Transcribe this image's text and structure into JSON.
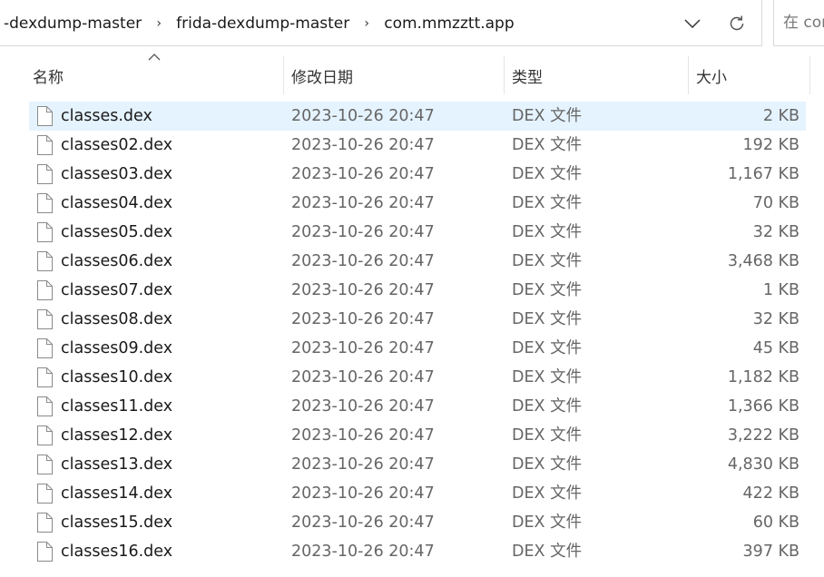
{
  "breadcrumb": {
    "items": [
      "-dexdump-master",
      "frida-dexdump-master",
      "com.mmzztt.app"
    ],
    "separator": "›"
  },
  "search": {
    "placeholder": "在 com"
  },
  "columns": {
    "name": "名称",
    "date": "修改日期",
    "type": "类型",
    "size": "大小"
  },
  "icons": {
    "dropdown": "chevron-down-icon",
    "refresh": "refresh-icon",
    "sort": "sort-ascending-icon",
    "file": "file-icon"
  },
  "colors": {
    "selected_row": "#e5f3ff",
    "border": "#d9d9d9"
  },
  "files": [
    {
      "name": "classes.dex",
      "date": "2023-10-26 20:47",
      "type": "DEX 文件",
      "size": "2 KB",
      "selected": true
    },
    {
      "name": "classes02.dex",
      "date": "2023-10-26 20:47",
      "type": "DEX 文件",
      "size": "192 KB"
    },
    {
      "name": "classes03.dex",
      "date": "2023-10-26 20:47",
      "type": "DEX 文件",
      "size": "1,167 KB"
    },
    {
      "name": "classes04.dex",
      "date": "2023-10-26 20:47",
      "type": "DEX 文件",
      "size": "70 KB"
    },
    {
      "name": "classes05.dex",
      "date": "2023-10-26 20:47",
      "type": "DEX 文件",
      "size": "32 KB"
    },
    {
      "name": "classes06.dex",
      "date": "2023-10-26 20:47",
      "type": "DEX 文件",
      "size": "3,468 KB"
    },
    {
      "name": "classes07.dex",
      "date": "2023-10-26 20:47",
      "type": "DEX 文件",
      "size": "1 KB"
    },
    {
      "name": "classes08.dex",
      "date": "2023-10-26 20:47",
      "type": "DEX 文件",
      "size": "32 KB"
    },
    {
      "name": "classes09.dex",
      "date": "2023-10-26 20:47",
      "type": "DEX 文件",
      "size": "45 KB"
    },
    {
      "name": "classes10.dex",
      "date": "2023-10-26 20:47",
      "type": "DEX 文件",
      "size": "1,182 KB"
    },
    {
      "name": "classes11.dex",
      "date": "2023-10-26 20:47",
      "type": "DEX 文件",
      "size": "1,366 KB"
    },
    {
      "name": "classes12.dex",
      "date": "2023-10-26 20:47",
      "type": "DEX 文件",
      "size": "3,222 KB"
    },
    {
      "name": "classes13.dex",
      "date": "2023-10-26 20:47",
      "type": "DEX 文件",
      "size": "4,830 KB"
    },
    {
      "name": "classes14.dex",
      "date": "2023-10-26 20:47",
      "type": "DEX 文件",
      "size": "422 KB"
    },
    {
      "name": "classes15.dex",
      "date": "2023-10-26 20:47",
      "type": "DEX 文件",
      "size": "60 KB"
    },
    {
      "name": "classes16.dex",
      "date": "2023-10-26 20:47",
      "type": "DEX 文件",
      "size": "397 KB"
    }
  ]
}
